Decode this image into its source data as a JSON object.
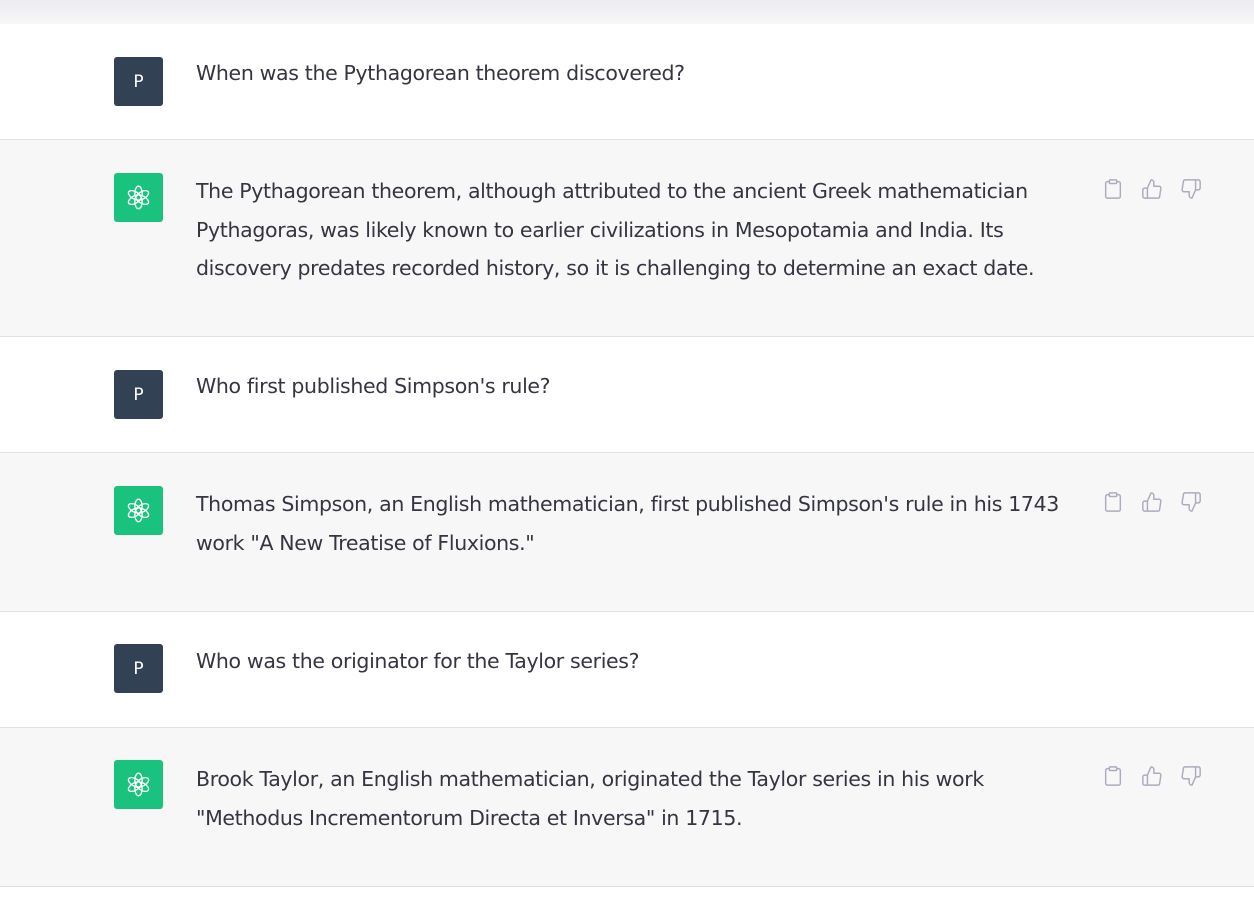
{
  "conversation": {
    "messages": [
      {
        "role": "user",
        "avatar_letter": "P",
        "text": "When was the Pythagorean theorem discovered?"
      },
      {
        "role": "assistant",
        "text": "The Pythagorean theorem, although attributed to the ancient Greek mathematician Pythagoras, was likely known to earlier civilizations in Mesopotamia and India. Its discovery predates recorded history, so it is challenging to determine an exact date."
      },
      {
        "role": "user",
        "avatar_letter": "P",
        "text": "Who first published Simpson's rule?"
      },
      {
        "role": "assistant",
        "text": "Thomas Simpson, an English mathematician, first published Simpson's rule in his 1743 work \"A New Treatise of Fluxions.\""
      },
      {
        "role": "user",
        "avatar_letter": "P",
        "text": "Who was the originator for the Taylor series?"
      },
      {
        "role": "assistant",
        "text": "Brook Taylor, an English mathematician, originated the Taylor series in his work \"Methodus Incrementorum Directa et Inversa\" in 1715."
      }
    ]
  },
  "icons": {
    "user_avatar": "user-avatar",
    "assistant_avatar": "openai-logo-icon",
    "copy": "clipboard-icon",
    "like": "thumbs-up-icon",
    "dislike": "thumbs-down-icon"
  },
  "colors": {
    "user_avatar_bg": "#334155",
    "assistant_avatar_bg": "#19c37d",
    "assistant_row_bg": "#f7f7f8",
    "text": "#343541",
    "icon": "#acacbe"
  }
}
